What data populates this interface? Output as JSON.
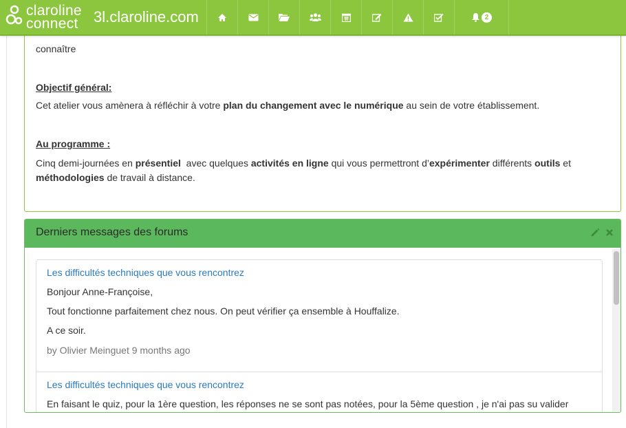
{
  "navbar": {
    "brand_line1": "claroline",
    "brand_line2": "connect",
    "site_name": "3l.claroline.com",
    "icons": [
      "home-icon",
      "envelope-icon",
      "folder-open-icon",
      "users-icon",
      "calendar-icon",
      "edit-icon",
      "warning-icon",
      "check-square-icon",
      "bell-icon"
    ],
    "notification_count": "2",
    "accent_color": "#8cc63e"
  },
  "description": {
    "partial_line": "connaître",
    "objectif_heading": "Objectif général:",
    "objectif_text_1": "Cet atelier vous amènera à réfléchir à votre ",
    "objectif_bold": "plan du changement avec le numérique",
    "objectif_text_2": " au sein de votre établissement.",
    "programme_heading": "Au programme :",
    "prog_1": "Cinq demi-journées en ",
    "prog_2": "présentiel",
    "prog_3": "  avec quelques ",
    "prog_4": "activités en ligne",
    "prog_5": " qui vous permettront d’",
    "prog_6": "expérimenter",
    "prog_7": " différents ",
    "prog_8": "outils",
    "prog_9": " et",
    "prog_10": "méthodologies",
    "prog_11": " de travail à distance."
  },
  "forum": {
    "title": "Derniers messages des forums",
    "header_color": "#5cb85c",
    "posts": [
      {
        "subject": "Les difficultés techniques que vous rencontrez",
        "lines": [
          "Bonjour Anne-Françoise,",
          "Tout fonctionne parfaitement chez nous. On peut vérifier ça ensemble à Houffalize.",
          "A ce soir."
        ],
        "meta": "by Olivier Meinguet 9 months ago"
      },
      {
        "subject": "Les difficultés techniques que vous rencontrez",
        "lines": [
          "En faisant le quiz,  pour la 1ère question, les réponses ne se sont pas notées, pour la 5ème question , je n'ai pas su valider"
        ]
      }
    ]
  }
}
